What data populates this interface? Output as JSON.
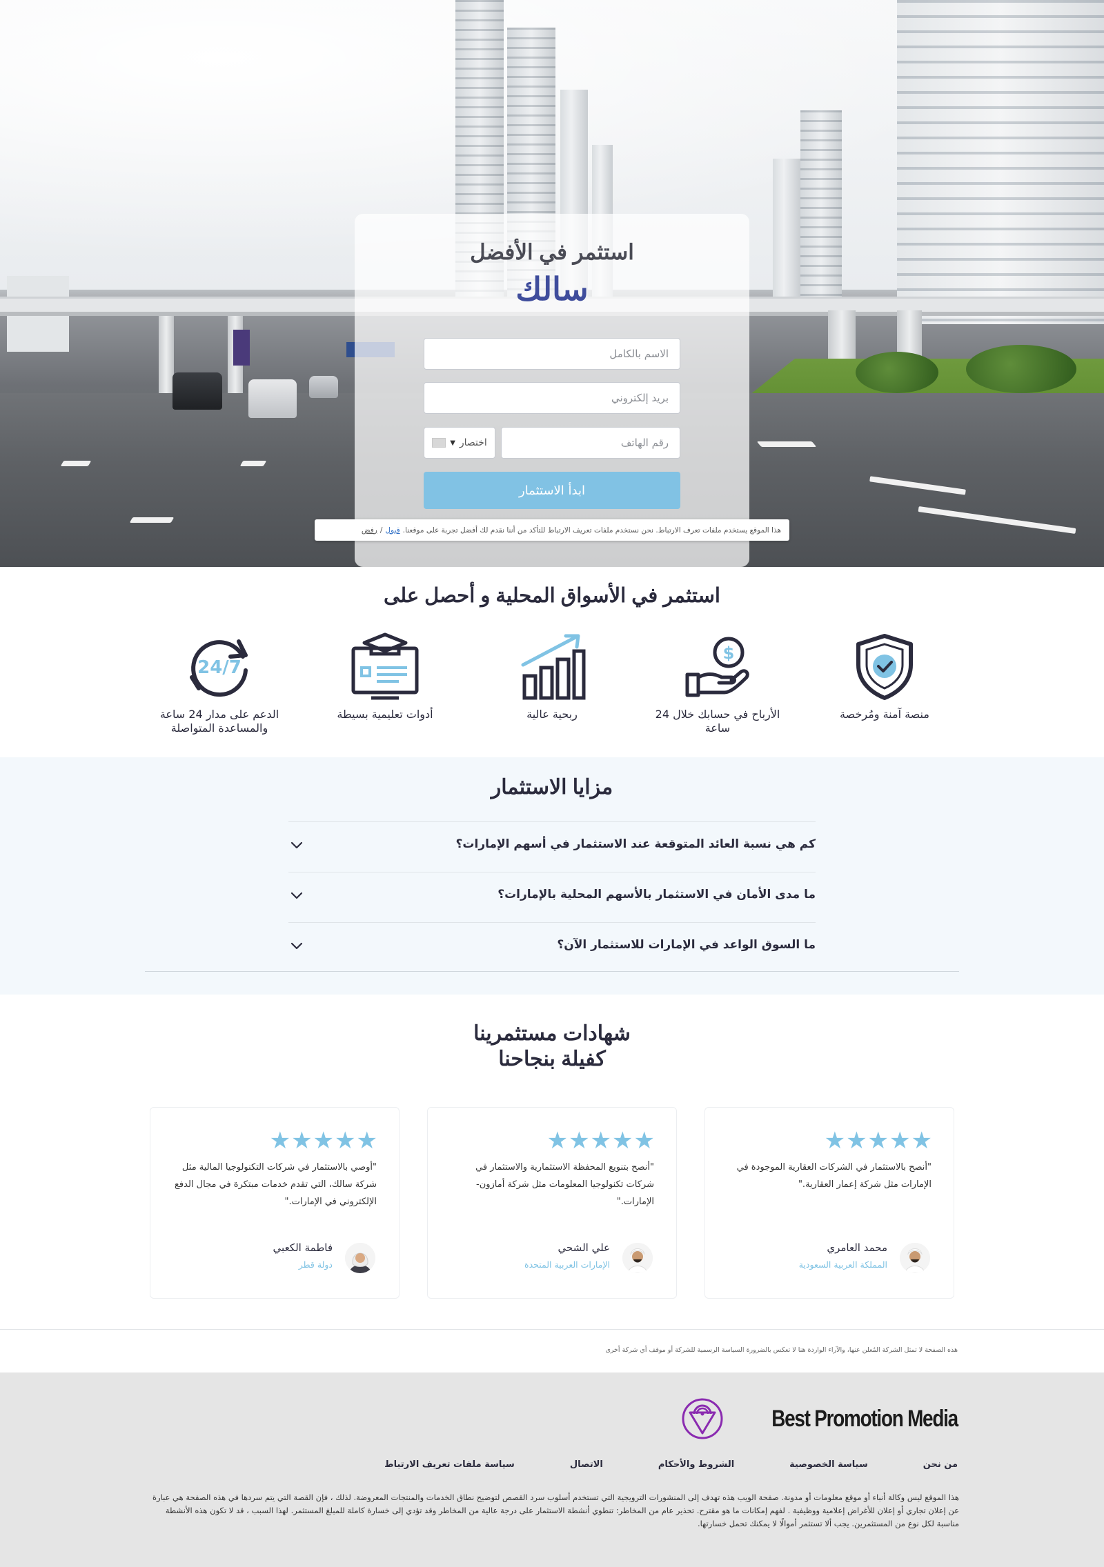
{
  "hero": {
    "title": "استثمر في الأفضل",
    "brand": "سالك",
    "form": {
      "name_placeholder": "الاسم بالكامل",
      "email_placeholder": "بريد إلكتروني",
      "phone_placeholder": "رقم الهاتف",
      "country_label": "اختصار",
      "submit_label": "ابدأ الاستثمار"
    },
    "cookie": {
      "text": "هذا الموقع يستخدم ملفات تعرف الارتباط. نحن نستخدم ملفات تعريف الارتباط للتأكد من أننا نقدم لك أفضل تجربة على موقعنا.",
      "accept": "قبول",
      "separator": "/",
      "reject": "رفض"
    }
  },
  "benefits": {
    "title": "استثمر في الأسواق المحلية و أحصل على",
    "items": [
      {
        "label": "منصة آمنة ومُرخصة",
        "icon": "shield-check-icon"
      },
      {
        "label": "الأرباح في حسابك خلال 24 ساعة",
        "icon": "hand-coin-icon"
      },
      {
        "label": "ربحية عالية",
        "icon": "bar-chart-growth-icon"
      },
      {
        "label": "أدوات تعليمية بسيطة",
        "icon": "education-screen-icon"
      },
      {
        "label": "الدعم على مدار 24 ساعة والمساعدة المتواصلة",
        "icon": "support-24-7-icon"
      }
    ]
  },
  "faq": {
    "title": "مزايا الاستثمار",
    "items": [
      {
        "q": "كم هي نسبة العائد المتوقعة عند الاستثمار في أسهم الإمارات؟"
      },
      {
        "q": "ما مدى الأمان في الاستثمار بالأسهم المحلية بالإمارات؟"
      },
      {
        "q": "ما السوق الواعد في الإمارات للاستثمار الآن؟"
      }
    ]
  },
  "testimonials": {
    "title_line1": "شهادات مستثمرينا",
    "title_line2": "كفيلة بنجاحنا",
    "stars": "★★★★★",
    "items": [
      {
        "text": "\"أنصح بالاستثمار في الشركات العقارية الموجودة في الإمارات مثل شركة إعمار العقارية.\"",
        "name": "محمد العامري",
        "country": "المملكة العربية السعودية"
      },
      {
        "text": "\"أنصح بتنويع المحفظة الاستثمارية والاستثمار في شركات تكنولوجيا المعلومات مثل شركة أمازون- الإمارات.\"",
        "name": "علي الشحي",
        "country": "الإمارات العربية المتحدة"
      },
      {
        "text": "\"أوصي بالاستثمار في شركات التكنولوجيا المالية مثل شركة سالك، التي تقدم خدمات مبتكرة في مجال الدفع الإلكتروني في الإمارات.\"",
        "name": "فاطمة الكعبي",
        "country": "دولة قطر"
      }
    ]
  },
  "disclaimer": "هذه الصفحة لا تمثل الشركة المُعلن عنها، والآراء الواردة هنا لا تعكس بالضرورة السياسة الرسمية للشركة أو موقف أي شركة أخرى",
  "footer": {
    "logo_text": "Best Promotion Media",
    "links": [
      "من نحن",
      "سياسة الخصوصية",
      "الشروط والأحكام",
      "الاتصال",
      "سياسة ملفات تعريف الارتباط"
    ],
    "text": "هذا الموقع ليس وكالة أنباء أو موقع معلومات أو مدونة. صفحة الويب هذه تهدف إلى المنشورات الترويجية التي تستخدم أسلوب سرد القصص لتوضيح نطاق الخدمات والمنتجات المعروضة. لذلك ، فإن القصة التي يتم سردها في هذه الصفحة هي عبارة عن إعلان تجاري أو إعلان للأغراض إعلامية ووظيفية . لفهم إمكانات ما هو مقترح. تحذير عام من المخاطر: تنطوي أنشطة الاستثمار على درجة عالية من المخاطر وقد تؤدي إلى خسارة كاملة للمبلغ المستثمر. لهذا السبب ، قد لا تكون هذه الأنشطة مناسبة لكل نوع من المستثمرين. يجب ألا تستثمر أموالًا لا يمكنك تحمل خسارتها."
  },
  "colors": {
    "accent": "#80c3e4",
    "brand": "#3f4d9c",
    "text": "#2b2b3d",
    "faq_band": "#f3f8fc",
    "footer_bg": "#e5e5e5"
  }
}
